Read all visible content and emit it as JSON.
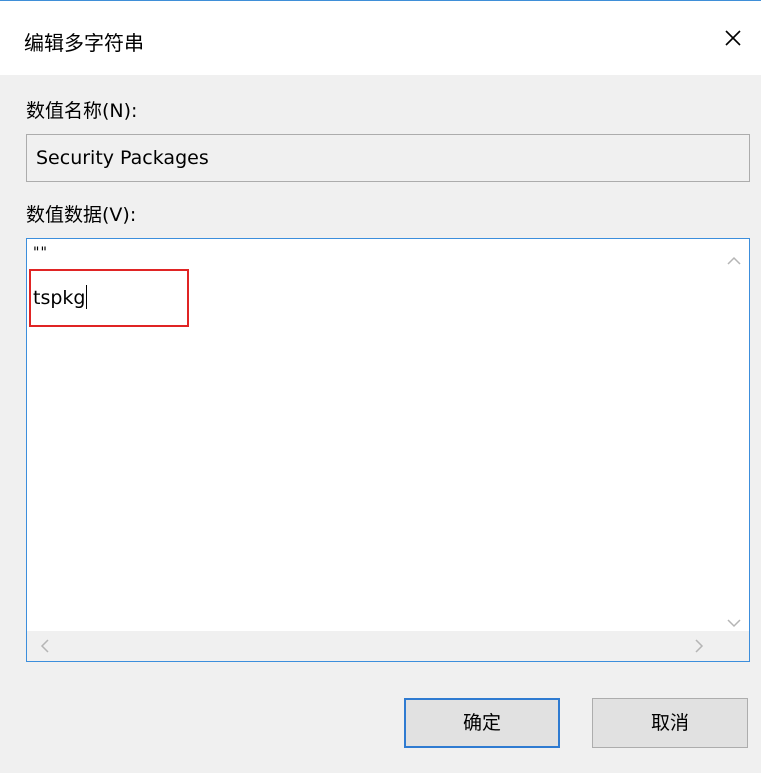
{
  "dialog": {
    "title": "编辑多字符串",
    "close_icon": "close-icon"
  },
  "value_name": {
    "label": "数值名称(N):",
    "value": "Security Packages"
  },
  "value_data": {
    "label": "数值数据(V):",
    "lines": [
      "\"\"",
      "tspkg"
    ],
    "highlight_color": "#e02424"
  },
  "buttons": {
    "ok_label": "确定",
    "cancel_label": "取消"
  },
  "colors": {
    "accent": "#2f7bd1",
    "focus_border": "#3c8edc"
  }
}
